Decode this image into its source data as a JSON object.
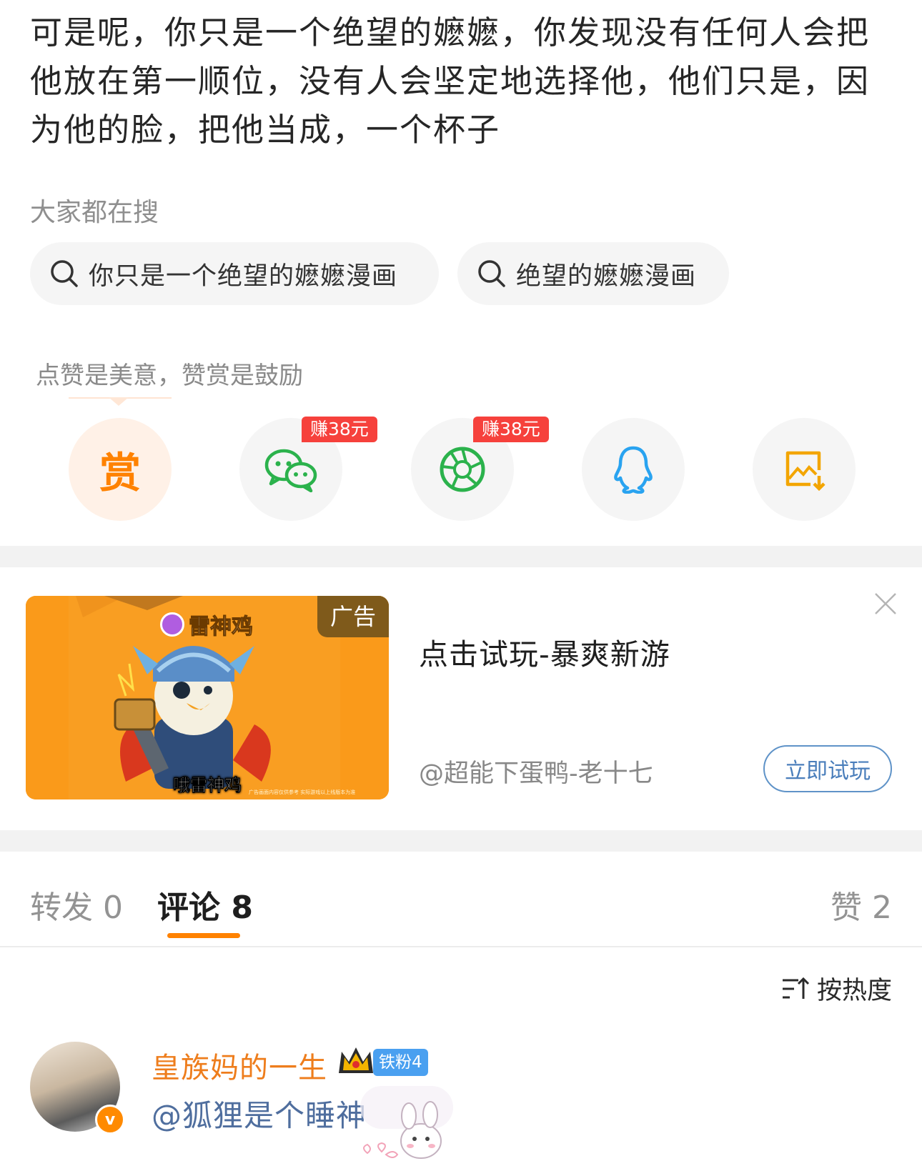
{
  "post": {
    "text": "可是呢，你只是一个绝望的嬷嬷，你发现没有任何人会把他放在第一顺位，没有人会坚定地选择他，他们只是，因为他的脸，把他当成，一个杯子"
  },
  "trending_search": {
    "heading": "大家都在搜",
    "chips": [
      {
        "label": "你只是一个绝望的嬷嬷漫画",
        "icon": "search-icon"
      },
      {
        "label": "绝望的嬷嬷漫画",
        "icon": "search-icon"
      }
    ]
  },
  "share": {
    "hint": "点赞是美意，赞赏是鼓励",
    "reward_glyph": "赏",
    "buttons": [
      {
        "name": "reward",
        "icon": "reward-icon",
        "color": "#ff8200"
      },
      {
        "name": "wechat",
        "icon": "wechat-icon",
        "color": "#2bb24c",
        "badge": "赚38元"
      },
      {
        "name": "moments",
        "icon": "camera-aperture-icon",
        "color": "#2bb24c",
        "badge": "赚38元"
      },
      {
        "name": "qq",
        "icon": "qq-penguin-icon",
        "color": "#29a3f0"
      },
      {
        "name": "save-image",
        "icon": "save-image-icon",
        "color": "#f3a500"
      }
    ]
  },
  "ad": {
    "tag": "广告",
    "brand": "雷神鸡",
    "caption": "哦雷神鸡",
    "fineprint": "广告画面内容仅供参考 实际游戏以上线版本为准",
    "title": "点击试玩-暴爽新游",
    "source": "@超能下蛋鸭-老十七",
    "cta": "立即试玩",
    "colors": {
      "image_bg": "#fa9a1a",
      "cta": "#4a7ebb"
    }
  },
  "tabs": {
    "repost": "转发 0",
    "comment": "评论 8",
    "like": "赞 2",
    "active": "comment",
    "accent": "#ff8200"
  },
  "sort": {
    "label": "按热度",
    "icon": "sort-icon"
  },
  "comments": [
    {
      "username": "皇族妈的一生",
      "fan_badge": "铁粉4",
      "verified_glyph": "v",
      "text": "@狐狸是个睡神",
      "name_color": "#ee7d1c"
    }
  ]
}
